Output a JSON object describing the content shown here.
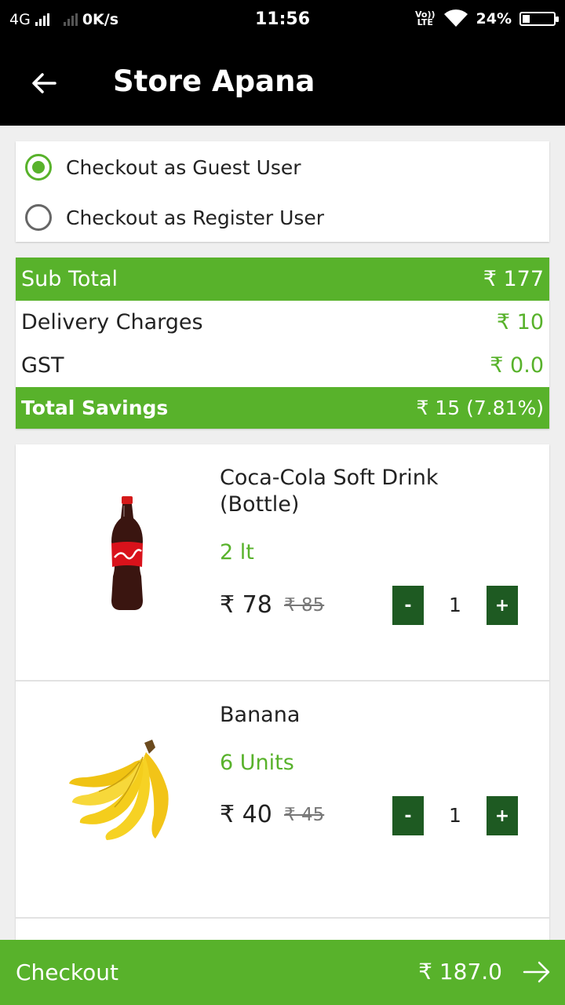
{
  "status_bar": {
    "network": "4G",
    "speed": "0K/s",
    "time": "11:56",
    "volte_top": "Vo))",
    "volte_bottom": "LTE",
    "battery": "24%",
    "battery_level": 0.24
  },
  "app_bar": {
    "title": "Store Apana",
    "back_icon": "arrow-left-icon"
  },
  "checkout_options": [
    {
      "label": "Checkout as Guest User",
      "selected": true
    },
    {
      "label": "Checkout as Register User",
      "selected": false
    }
  ],
  "summary": {
    "sub_total_label": "Sub Total",
    "sub_total_value": "₹ 177",
    "delivery_label": "Delivery Charges",
    "delivery_value": "₹ 10",
    "gst_label": "GST",
    "gst_value": "₹ 0.0",
    "savings_label": "Total Savings",
    "savings_value": "₹ 15 (7.81%)"
  },
  "products": [
    {
      "name": "Coca-Cola Soft Drink (Bottle)",
      "quantity_unit": "2 lt",
      "price": "₹ 78",
      "mrp": "₹ 85",
      "count": "1",
      "minus_label": "-",
      "plus_label": "+"
    },
    {
      "name": "Banana",
      "quantity_unit": "6 Units",
      "price": "₹ 40",
      "mrp": "₹ 45",
      "count": "1",
      "minus_label": "-",
      "plus_label": "+"
    }
  ],
  "checkout_bar": {
    "label": "Checkout",
    "total": "₹ 187.0",
    "arrow_icon": "arrow-right-icon"
  },
  "colors": {
    "accent_green": "#58b22b",
    "stepper_green": "#1e5a22",
    "bar_black": "#000000"
  }
}
